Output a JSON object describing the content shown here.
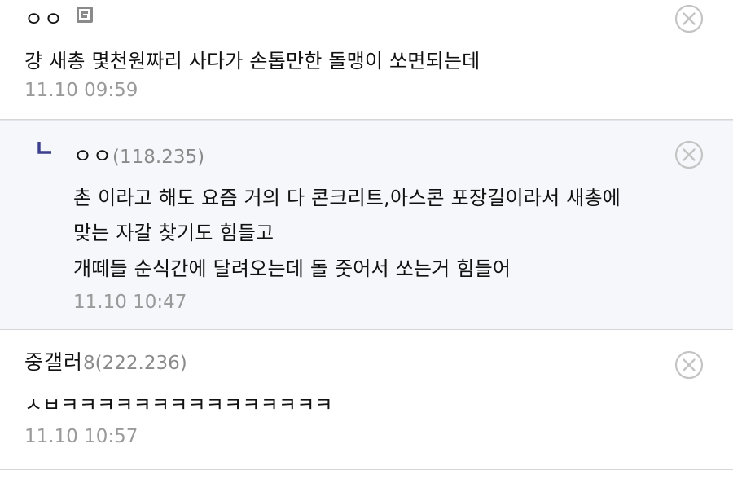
{
  "comments": [
    {
      "nick": "ㅇㅇ",
      "ip": "",
      "lines": [
        "걍 새총 몇천원짜리 사다가 손톱만한 돌맹이 쏘면되는데"
      ],
      "time": "11.10 09:59",
      "fixed_icon": "fixed-nick-icon",
      "delete_icon": "delete-circle-x-icon"
    },
    {
      "nick": "ㅇㅇ",
      "ip": "(118.235)",
      "lines": [
        "촌 이라고 해도 요즘 거의 다 콘크리트,아스콘 포장길이라서 새총에",
        "맞는 자갈 찾기도 힘들고",
        "개떼들 순식간에 달려오는데 돌 줏어서 쏘는거 힘들어"
      ],
      "time": "11.10 10:47",
      "reply_icon": "reply-arrow-icon",
      "delete_icon": "delete-circle-x-icon"
    },
    {
      "nick": "중갤러",
      "ip": "8(222.236)",
      "lines": [
        "ㅅㅂㅋㅋㅋㅋㅋㅋㅋㅋㅋㅋㅋㅋㅋㅋㅋ"
      ],
      "time": "11.10 10:57",
      "delete_icon": "delete-circle-x-icon"
    }
  ],
  "colors": {
    "text": "#111111",
    "meta": "#9a9a9a",
    "reply_bg": "#f6f7fb",
    "reply_mark": "#3b3f8c",
    "divider": "#d6d6d6"
  }
}
